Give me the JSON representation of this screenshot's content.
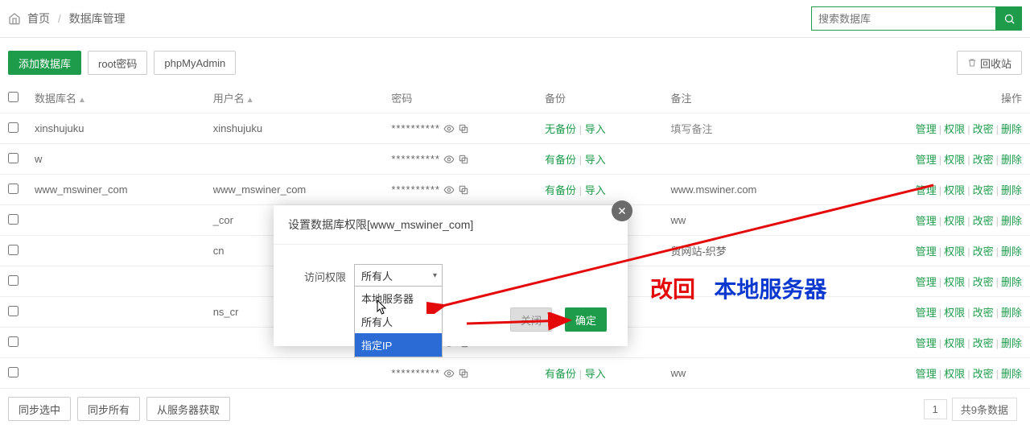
{
  "breadcrumb": {
    "home": "首页",
    "current": "数据库管理"
  },
  "search": {
    "placeholder": "搜索数据库"
  },
  "toolbar": {
    "add_db": "添加数据库",
    "root_pwd": "root密码",
    "phpmyadmin": "phpMyAdmin",
    "recycle": "回收站"
  },
  "table": {
    "headers": {
      "dbname": "数据库名",
      "user": "用户名",
      "password": "密码",
      "backup": "备份",
      "remark": "备注",
      "ops": "操作"
    },
    "password_mask": "**********",
    "no_backup": "无备份",
    "has_backup": "有备份",
    "import": "导入",
    "fill_remark": "填写备注",
    "op_labels": {
      "manage": "管理",
      "perm": "权限",
      "chpwd": "改密",
      "del": "删除"
    },
    "rows": [
      {
        "dbname": "xinshujuku",
        "user": "xinshujuku",
        "backup": "no",
        "remark_kind": "placeholder"
      },
      {
        "dbname": "w",
        "user": "",
        "backup": "has",
        "remark": ""
      },
      {
        "dbname": "www_mswiner_com",
        "user": "www_mswiner_com",
        "backup": "has",
        "remark": "www.mswiner.com"
      },
      {
        "dbname": "",
        "user": "_cor",
        "backup": "",
        "remark": "ww"
      },
      {
        "dbname": "",
        "user": "cn",
        "backup": "",
        "remark": "贸网站-织梦"
      },
      {
        "dbname": "",
        "user": "",
        "backup": "",
        "remark": ""
      },
      {
        "dbname": "",
        "user": "ns_cr",
        "backup": "",
        "remark": ""
      },
      {
        "dbname": "",
        "user": "",
        "backup": "",
        "remark": ""
      },
      {
        "dbname": "",
        "user": "",
        "backup": "has",
        "remark": "ww"
      }
    ]
  },
  "bottom": {
    "sync_selected": "同步选中",
    "sync_all": "同步所有",
    "get_from_server": "从服务器获取",
    "page": "1",
    "total": "共9条数据"
  },
  "modal": {
    "title_prefix": "设置数据库权限[",
    "title_db": "www_mswiner_com",
    "title_suffix": "]",
    "label": "访问权限",
    "selected": "所有人",
    "options": [
      "本地服务器",
      "所有人",
      "指定IP"
    ],
    "cancel": "关闭",
    "ok": "确定"
  },
  "annotation": {
    "part1": "改回",
    "part2": "本地服务器"
  }
}
